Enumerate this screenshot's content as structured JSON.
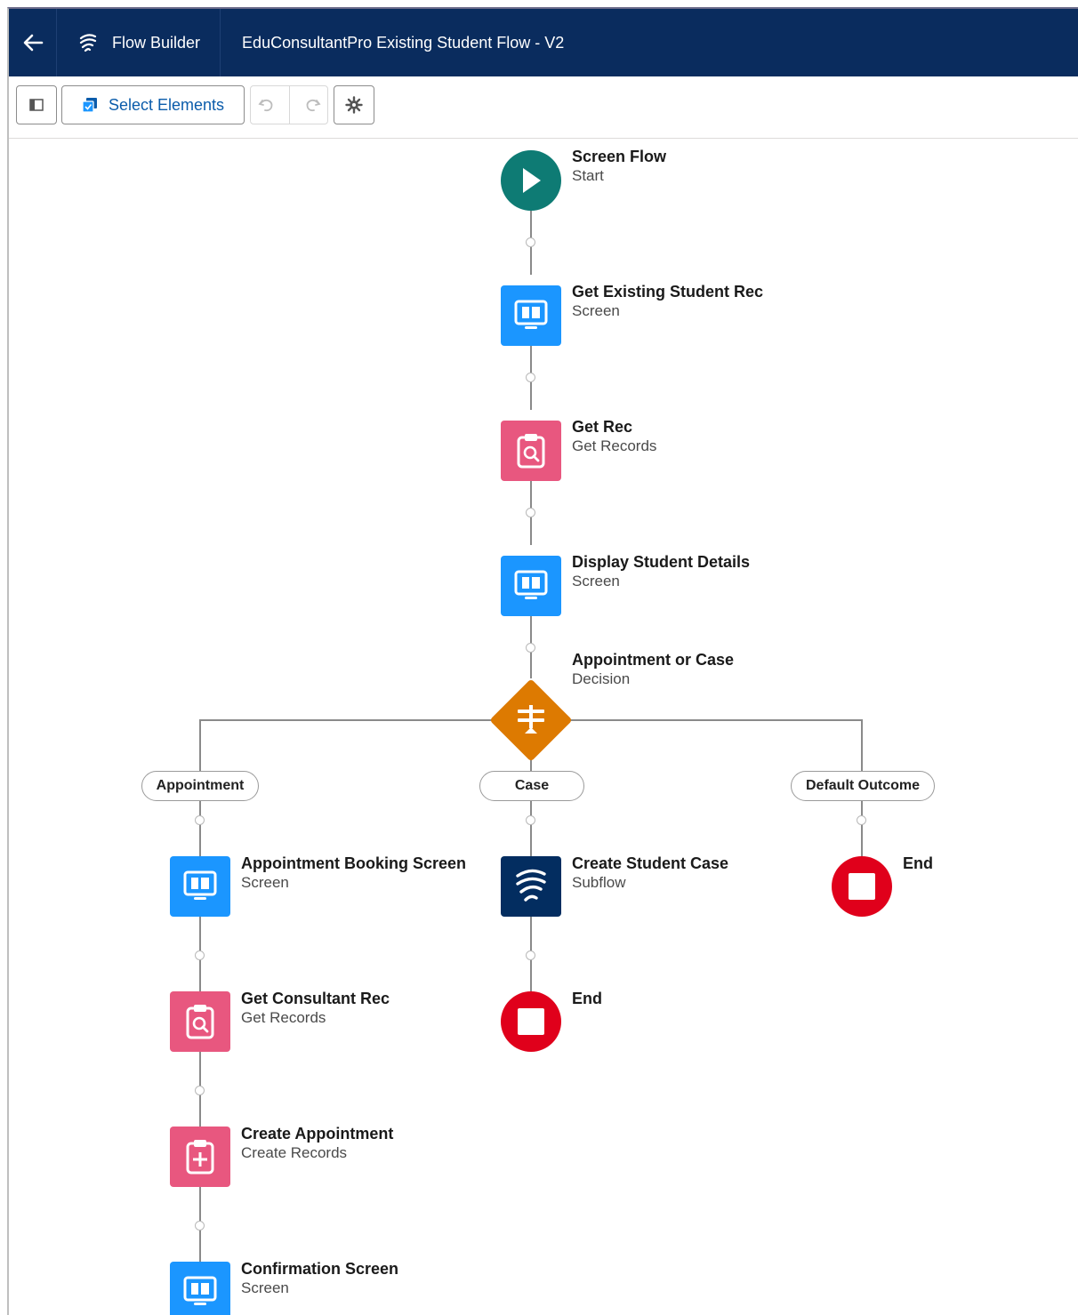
{
  "header": {
    "app_name": "Flow Builder",
    "flow_title": "EduConsultantPro Existing Student Flow - V2"
  },
  "toolbar": {
    "select_elements_label": "Select Elements"
  },
  "colors": {
    "header_bg": "#0a2c5e",
    "screen": "#1b96ff",
    "records": "#e8577f",
    "decision": "#dd7a01",
    "start": "#0e7b74",
    "end": "#e0001b",
    "subflow": "#032d60"
  },
  "flow": {
    "start": {
      "title": "Screen Flow",
      "subtitle": "Start"
    },
    "get_existing": {
      "title": "Get Existing Student Rec",
      "subtitle": "Screen"
    },
    "get_rec": {
      "title": "Get Rec",
      "subtitle": "Get Records"
    },
    "display_details": {
      "title": "Display Student Details",
      "subtitle": "Screen"
    },
    "decision": {
      "title": "Appointment or Case",
      "subtitle": "Decision"
    },
    "outcomes": {
      "appointment": "Appointment",
      "case": "Case",
      "default": "Default Outcome"
    },
    "appointment_booking": {
      "title": "Appointment Booking Screen",
      "subtitle": "Screen"
    },
    "get_consultant": {
      "title": "Get Consultant Rec",
      "subtitle": "Get Records"
    },
    "create_appointment": {
      "title": "Create Appointment",
      "subtitle": "Create Records"
    },
    "confirmation": {
      "title": "Confirmation Screen",
      "subtitle": "Screen"
    },
    "create_case": {
      "title": "Create Student Case",
      "subtitle": "Subflow"
    },
    "case_end": {
      "title": "End"
    },
    "default_end": {
      "title": "End"
    }
  }
}
